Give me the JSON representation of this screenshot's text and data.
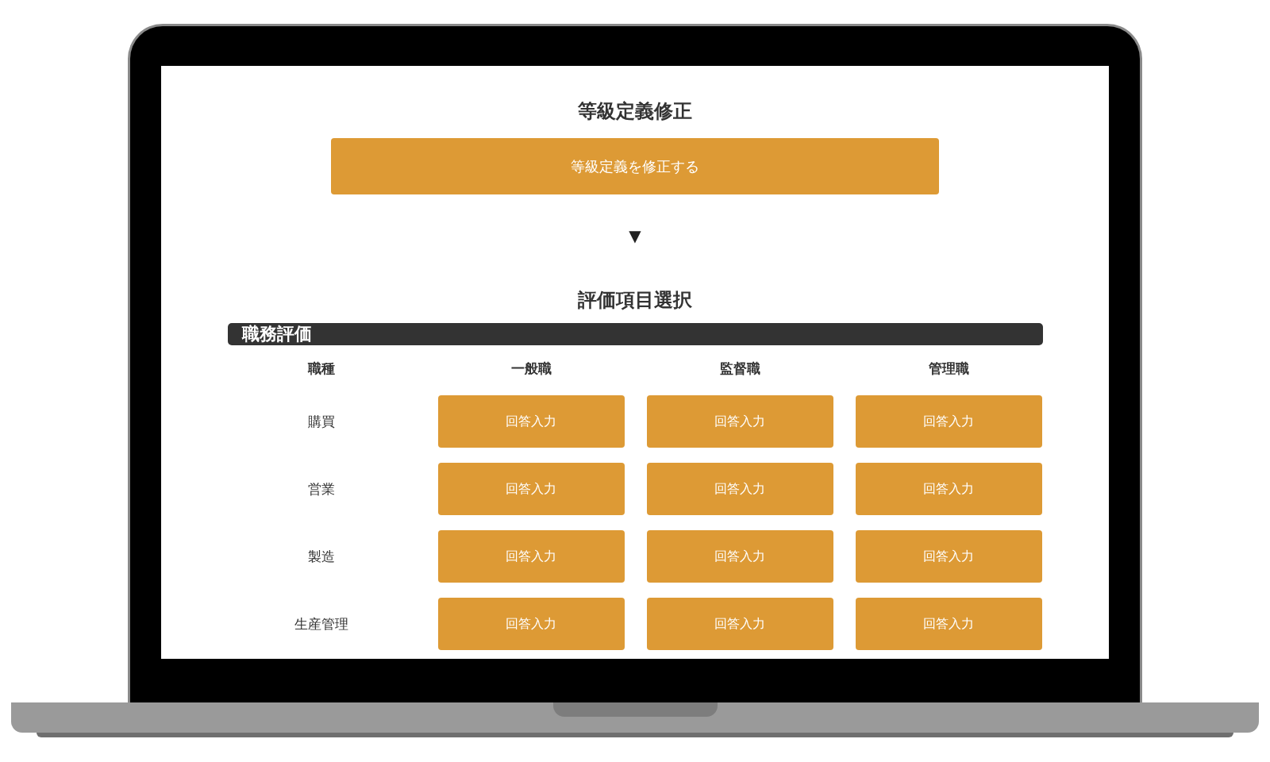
{
  "screen_title": "等級定義修正",
  "modify_button": "等級定義を修正する",
  "arrow": "▼",
  "section_title": "評価項目選択",
  "category_bar": "職務評価",
  "table": {
    "columns": [
      "職種",
      "一般職",
      "監督職",
      "管理職"
    ],
    "rows": [
      {
        "label": "購買",
        "buttons": [
          "回答入力",
          "回答入力",
          "回答入力"
        ]
      },
      {
        "label": "営業",
        "buttons": [
          "回答入力",
          "回答入力",
          "回答入力"
        ]
      },
      {
        "label": "製造",
        "buttons": [
          "回答入力",
          "回答入力",
          "回答入力"
        ]
      },
      {
        "label": "生産管理",
        "buttons": [
          "回答入力",
          "回答入力",
          "回答入力"
        ]
      }
    ]
  }
}
